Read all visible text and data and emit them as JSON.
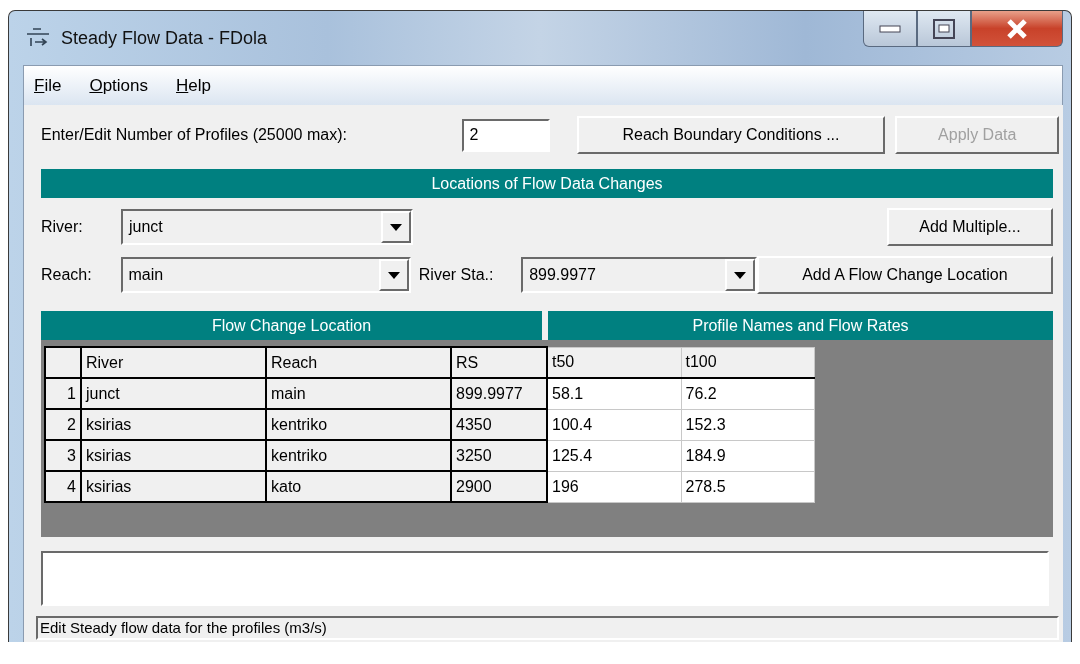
{
  "window": {
    "title": "Steady Flow Data - FDola"
  },
  "menu": [
    {
      "label": "File"
    },
    {
      "label": "Options"
    },
    {
      "label": "Help"
    }
  ],
  "profiles": {
    "label": "Enter/Edit Number of Profiles (25000 max):",
    "value": "2"
  },
  "top_buttons": [
    {
      "label": "Reach Boundary Conditions ...",
      "disabled": false
    },
    {
      "label": "Apply Data",
      "disabled": true
    }
  ],
  "locations_header": "Locations of Flow Data Changes",
  "river": {
    "label": "River:",
    "value": "junct"
  },
  "add_multiple": "Add Multiple...",
  "reach": {
    "label": "Reach:",
    "value": "main"
  },
  "river_sta": {
    "label": "River Sta.:",
    "value": "899.9977"
  },
  "add_location": "Add A Flow Change Location",
  "table": {
    "location_header": "Flow Change Location",
    "profile_header": "Profile Names and Flow Rates",
    "location_columns": [
      "River",
      "Reach",
      "RS"
    ],
    "profile_columns": [
      "t50",
      "t100"
    ],
    "rows": [
      {
        "number": "1",
        "cells": [
          "junct",
          "main",
          "899.9977"
        ],
        "flows": [
          "58.1",
          "76.2"
        ]
      },
      {
        "number": "2",
        "cells": [
          "ksirias",
          "kentriko",
          "4350"
        ],
        "flows": [
          "100.4",
          "152.3"
        ]
      },
      {
        "number": "3",
        "cells": [
          "ksirias",
          "kentriko",
          "3250"
        ],
        "flows": [
          "125.4",
          "184.9"
        ]
      },
      {
        "number": "4",
        "cells": [
          "ksirias",
          "kato",
          "2900"
        ],
        "flows": [
          "196",
          "278.5"
        ]
      }
    ]
  },
  "status_bar": "Edit Steady flow data for the profiles (m3/s)"
}
